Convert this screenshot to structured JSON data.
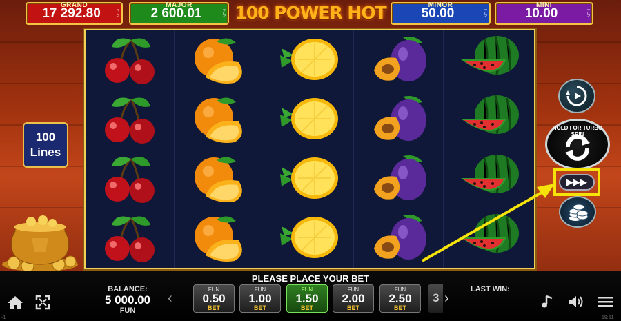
{
  "jackpots": [
    {
      "label": "GRAND",
      "value": "17 292.80",
      "currency": "FUN",
      "color": "#c31212"
    },
    {
      "label": "MAJOR",
      "value": "2 600.01",
      "currency": "FUN",
      "color": "#1f8a1c"
    },
    {
      "label": "MINOR",
      "value": "50.00",
      "currency": "FUN",
      "color": "#1a47b5"
    },
    {
      "label": "MINI",
      "value": "10.00",
      "currency": "FUN",
      "color": "#7b1aa3"
    }
  ],
  "title": "100 POWER HOT",
  "lines": {
    "number": "100",
    "word": "Lines"
  },
  "reels": [
    {
      "symbol": "cherry"
    },
    {
      "symbol": "orange"
    },
    {
      "symbol": "lemon"
    },
    {
      "symbol": "plum"
    },
    {
      "symbol": "watermelon"
    }
  ],
  "buttons": {
    "turbo_ring_text": "HOLD FOR TURBO SPIN",
    "turbo_glyph": "▶▶▶"
  },
  "bottom": {
    "place_text": "PLEASE PLACE YOUR BET",
    "balance_label": "BALANCE:",
    "balance_value": "5 000.00",
    "balance_currency": "FUN",
    "last_win_label": "LAST WIN:",
    "prev_arrow": "‹",
    "next_arrow": "›",
    "bets": [
      {
        "fun": "FUN",
        "amount": "0.50",
        "bet": "BET",
        "selected": false
      },
      {
        "fun": "FUN",
        "amount": "1.00",
        "bet": "BET",
        "selected": false
      },
      {
        "fun": "FUN",
        "amount": "1.50",
        "bet": "BET",
        "selected": true
      },
      {
        "fun": "FUN",
        "amount": "2.00",
        "bet": "BET",
        "selected": false
      },
      {
        "fun": "FUN",
        "amount": "2.50",
        "bet": "BET",
        "selected": false
      }
    ],
    "partial_bet": "3",
    "clock": "19:51",
    "corner": "-1"
  },
  "colors": {
    "highlight": "#f5e30a",
    "reel_bg": "#0f1838",
    "frame": "#f1d05a"
  },
  "icons": [
    "home-icon",
    "fullscreen-icon",
    "music-icon",
    "volume-icon",
    "menu-icon",
    "autoplay-icon",
    "spin-icon",
    "turbo-icon",
    "coins-icon",
    "gold-pot-icon"
  ]
}
